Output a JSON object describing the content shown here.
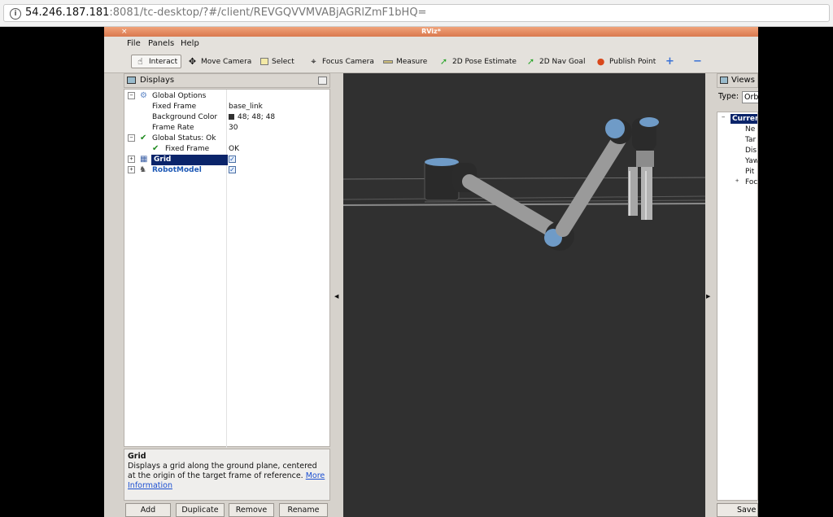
{
  "browser": {
    "url_host": "54.246.187.181",
    "url_path": ":8081/tc-desktop/?#/client/REVGQVVMVABjAGRlZmF1bHQ="
  },
  "window": {
    "title": "RViz*"
  },
  "menu": {
    "file": "File",
    "panels": "Panels",
    "help": "Help"
  },
  "toolbar": {
    "interact": "Interact",
    "move_camera": "Move Camera",
    "select": "Select",
    "focus_camera": "Focus Camera",
    "measure": "Measure",
    "pose_estimate": "2D Pose Estimate",
    "nav_goal": "2D Nav Goal",
    "publish_point": "Publish Point",
    "plus": "+",
    "minus": "−"
  },
  "displays": {
    "title": "Displays",
    "global_options": "Global Options",
    "fixed_frame_label": "Fixed Frame",
    "fixed_frame_value": "base_link",
    "bg_color_label": "Background Color",
    "bg_color_value": "48; 48; 48",
    "frame_rate_label": "Frame Rate",
    "frame_rate_value": "30",
    "global_status": "Global Status: Ok",
    "status_fixed_frame": "Fixed Frame",
    "status_fixed_frame_value": "OK",
    "grid": "Grid",
    "robot_model": "RobotModel",
    "expand_plus": "+",
    "collapse_minus": "−",
    "check": "✓"
  },
  "description": {
    "title": "Grid",
    "text": "Displays a grid along the ground plane, centered at the origin of the target frame of reference.",
    "link": "More Information"
  },
  "buttons": {
    "add": "Add",
    "duplicate": "Duplicate",
    "remove": "Remove",
    "rename": "Rename"
  },
  "views": {
    "title": "Views",
    "type_label": "Type:",
    "type_value": "Orbit",
    "current": "Current",
    "items": [
      "Ne",
      "Tar",
      "Dis",
      "Yaw",
      "Pit",
      "Foc"
    ],
    "save": "Save"
  },
  "colors": {
    "background_3d": "#303030",
    "titlebar": "#e08a5e",
    "joint_cap": "#6f9bc7",
    "selection": "#0a246a"
  }
}
